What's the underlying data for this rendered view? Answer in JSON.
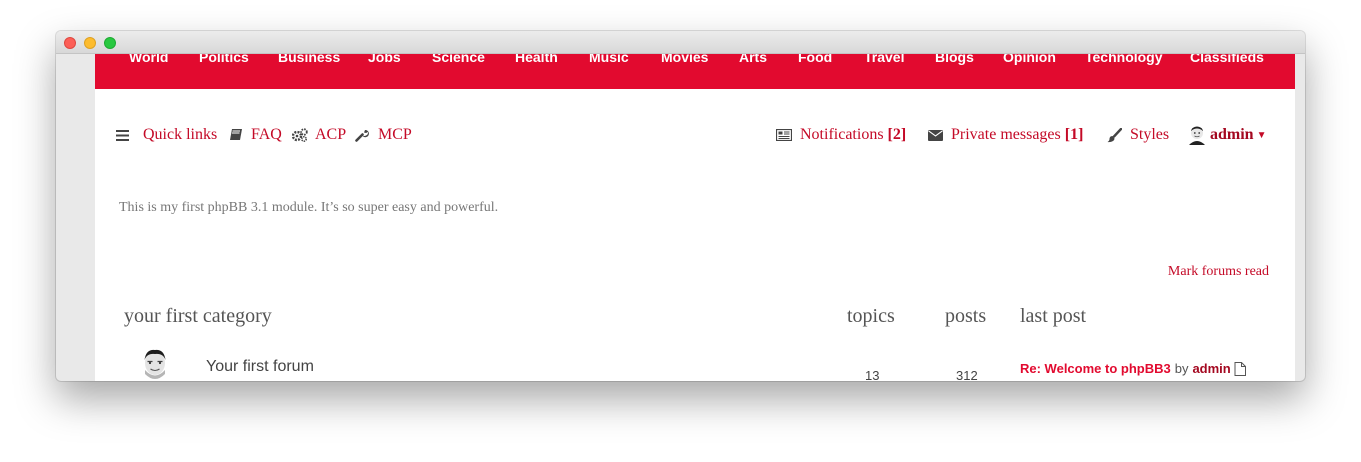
{
  "topnav": {
    "items": [
      "World",
      "Politics",
      "Business",
      "Jobs",
      "Science",
      "Health",
      "Music",
      "Movies",
      "Arts",
      "Food",
      "Travel",
      "Blogs",
      "Opinion",
      "Technology",
      "Classifieds"
    ]
  },
  "navbar": {
    "quick_links": "Quick links",
    "faq": "FAQ",
    "acp": "ACP",
    "mcp": "MCP",
    "notifications": "Notifications",
    "notifications_count": "[2]",
    "private_messages": "Private messages",
    "private_messages_count": "[1]",
    "styles": "Styles",
    "username": "admin"
  },
  "welcome_text": "This is my first phpBB 3.1 module. It’s so super easy and powerful.",
  "mark_read": "Mark forums read",
  "category": {
    "title": "your first category",
    "col_topics": "topics",
    "col_posts": "posts",
    "col_last_post": "last post"
  },
  "forum": {
    "name": "Your first forum",
    "topics": "13",
    "posts": "312",
    "last_post_title": "Re: Welcome to phpBB3",
    "last_post_by": "by",
    "last_post_user": "admin"
  },
  "colors": {
    "brand_red": "#e20a2f",
    "link_red": "#c40a27",
    "dark_red": "#a40820"
  }
}
